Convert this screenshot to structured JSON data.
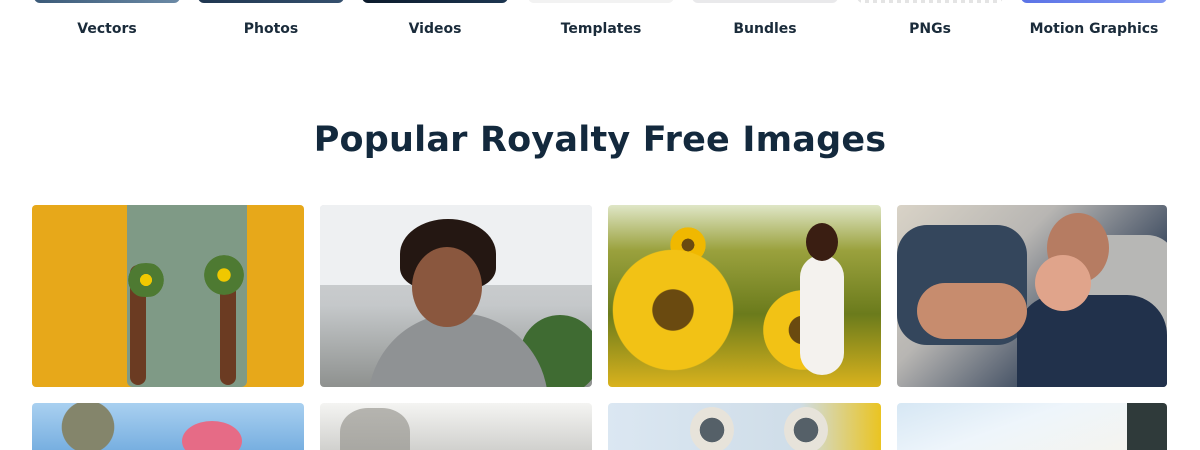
{
  "categories": [
    {
      "label": "Vectors",
      "icon": "vectors-thumbnail"
    },
    {
      "label": "Photos",
      "icon": "photos-thumbnail"
    },
    {
      "label": "Videos",
      "icon": "videos-thumbnail"
    },
    {
      "label": "Templates",
      "icon": "templates-thumbnail"
    },
    {
      "label": "Bundles",
      "icon": "bundles-thumbnail"
    },
    {
      "label": "PNGs",
      "icon": "pngs-thumbnail"
    },
    {
      "label": "Motion Graphics",
      "icon": "motion-graphics-thumbnail"
    }
  ],
  "section": {
    "title": "Popular Royalty Free Images"
  },
  "colors": {
    "heading": "#13293d",
    "category_text": "#1a2b3a",
    "background": "#ffffff"
  }
}
